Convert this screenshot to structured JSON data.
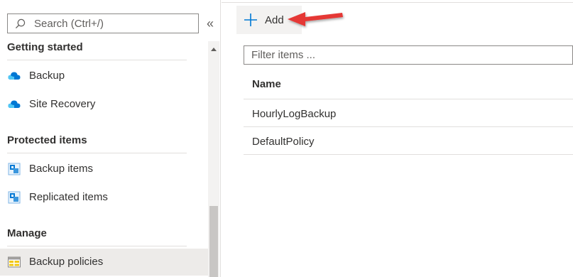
{
  "sidebar": {
    "search": {
      "placeholder": "Search (Ctrl+/)"
    },
    "collapse_glyph": "«",
    "groups": [
      {
        "heading": "Getting started",
        "items": [
          {
            "label": "Backup",
            "icon": "cloud-backup-icon"
          },
          {
            "label": "Site Recovery",
            "icon": "cloud-site-recovery-icon"
          }
        ]
      },
      {
        "heading": "Protected items",
        "items": [
          {
            "label": "Backup items",
            "icon": "backup-items-icon"
          },
          {
            "label": "Replicated items",
            "icon": "replicated-items-icon"
          }
        ]
      },
      {
        "heading": "Manage",
        "items": [
          {
            "label": "Backup policies",
            "icon": "backup-policies-icon",
            "selected": true
          }
        ]
      }
    ]
  },
  "toolbar": {
    "add_label": "Add"
  },
  "filter": {
    "placeholder": "Filter items ..."
  },
  "table": {
    "columns": [
      "Name"
    ],
    "rows": [
      {
        "name": "HourlyLogBackup"
      },
      {
        "name": "DefaultPolicy"
      }
    ]
  },
  "colors": {
    "accent": "#0078d4",
    "annotation_arrow": "#e53935",
    "selected_bg": "#edebe9"
  }
}
